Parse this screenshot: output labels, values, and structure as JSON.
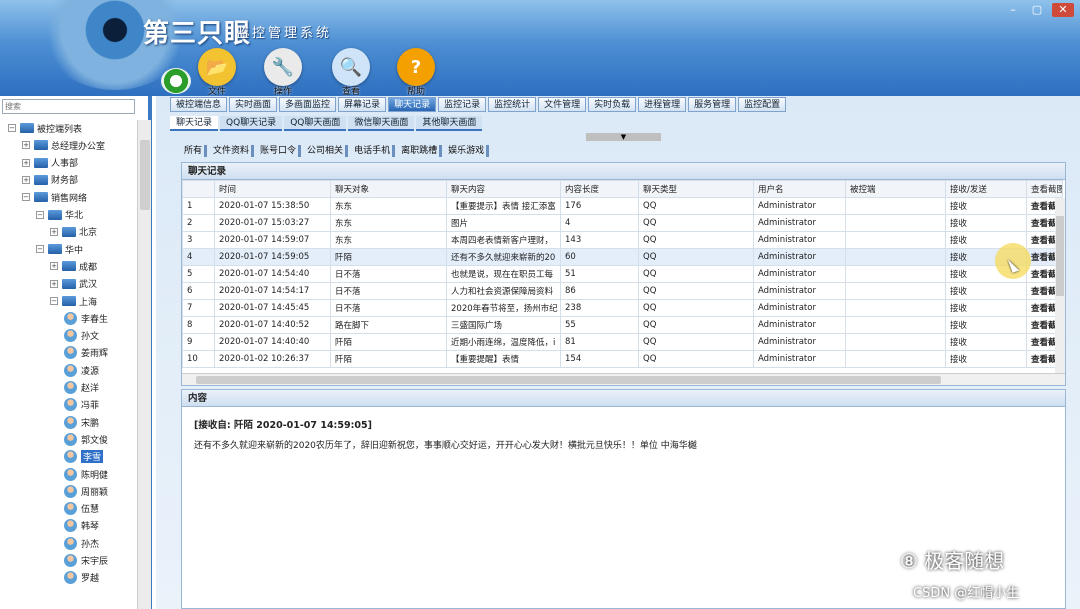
{
  "app": {
    "brand": "第三只眼",
    "subtitle": "监控管理系统"
  },
  "window_controls": [
    "–",
    "▢",
    "✕"
  ],
  "toolbar": [
    {
      "label": "文件",
      "icon": "folder-icon",
      "color": "#f2c230",
      "glyph": "📂"
    },
    {
      "label": "操作",
      "icon": "tools-icon",
      "color": "#eaeaea",
      "glyph": "🔧"
    },
    {
      "label": "查看",
      "icon": "magnifier-icon",
      "color": "#cfe4f8",
      "glyph": "🔍"
    },
    {
      "label": "帮助",
      "icon": "help-icon",
      "color": "#f4a000",
      "glyph": "?"
    }
  ],
  "sidebar": {
    "search_placeholder": "搜索",
    "tree": [
      {
        "label": "被控端列表",
        "indent": 0,
        "exp": "−",
        "type": "folder"
      },
      {
        "label": "总经理办公室",
        "indent": 1,
        "exp": "+",
        "type": "folder"
      },
      {
        "label": "人事部",
        "indent": 1,
        "exp": "+",
        "type": "folder"
      },
      {
        "label": "财务部",
        "indent": 1,
        "exp": "+",
        "type": "folder"
      },
      {
        "label": "销售网络",
        "indent": 1,
        "exp": "−",
        "type": "folder"
      },
      {
        "label": "华北",
        "indent": 2,
        "exp": "−",
        "type": "folder"
      },
      {
        "label": "北京",
        "indent": 3,
        "exp": "+",
        "type": "folder"
      },
      {
        "label": "华中",
        "indent": 2,
        "exp": "−",
        "type": "folder"
      },
      {
        "label": "成都",
        "indent": 3,
        "exp": "+",
        "type": "folder"
      },
      {
        "label": "武汉",
        "indent": 3,
        "exp": "+",
        "type": "folder"
      },
      {
        "label": "上海",
        "indent": 3,
        "exp": "−",
        "type": "folder"
      },
      {
        "label": "李春生",
        "indent": 4,
        "type": "user"
      },
      {
        "label": "孙文",
        "indent": 4,
        "type": "user"
      },
      {
        "label": "姜雨辉",
        "indent": 4,
        "type": "user"
      },
      {
        "label": "凌源",
        "indent": 4,
        "type": "user"
      },
      {
        "label": "赵洋",
        "indent": 4,
        "type": "user"
      },
      {
        "label": "冯菲",
        "indent": 4,
        "type": "user"
      },
      {
        "label": "宋鹏",
        "indent": 4,
        "type": "user"
      },
      {
        "label": "郭文俊",
        "indent": 4,
        "type": "user"
      },
      {
        "label": "李雪",
        "indent": 4,
        "type": "user",
        "selected": true
      },
      {
        "label": "陈明健",
        "indent": 4,
        "type": "user"
      },
      {
        "label": "周丽颖",
        "indent": 4,
        "type": "user"
      },
      {
        "label": "伍慧",
        "indent": 4,
        "type": "user"
      },
      {
        "label": "韩琴",
        "indent": 4,
        "type": "user"
      },
      {
        "label": "孙杰",
        "indent": 4,
        "type": "user"
      },
      {
        "label": "宋宇辰",
        "indent": 4,
        "type": "user"
      },
      {
        "label": "罗越",
        "indent": 4,
        "type": "user"
      }
    ]
  },
  "main_tabs": [
    {
      "label": "被控端信息"
    },
    {
      "label": "实时画面"
    },
    {
      "label": "多画面监控"
    },
    {
      "label": "屏幕记录"
    },
    {
      "label": "聊天记录",
      "active": true
    },
    {
      "label": "监控记录"
    },
    {
      "label": "监控统计"
    },
    {
      "label": "文件管理"
    },
    {
      "label": "实时负载"
    },
    {
      "label": "进程管理"
    },
    {
      "label": "服务管理"
    },
    {
      "label": "监控配置"
    }
  ],
  "sub_tabs": [
    {
      "label": "聊天记录",
      "active": true
    },
    {
      "label": "QQ聊天记录"
    },
    {
      "label": "QQ聊天画面"
    },
    {
      "label": "微信聊天画面"
    },
    {
      "label": "其他聊天画面"
    }
  ],
  "collapse_glyph": "▼",
  "filters": [
    "所有",
    "文件资料",
    "账号口令",
    "公司相关",
    "电话手机",
    "离职跳槽",
    "娱乐游戏"
  ],
  "grid": {
    "title": "聊天记录",
    "columns": [
      "",
      "时间",
      "聊天对象",
      "聊天内容",
      "内容长度",
      "聊天类型",
      "用户名",
      "被控端",
      "接收/发送",
      "查看截图"
    ],
    "rows": [
      [
        "1",
        "2020-01-07 15:38:50",
        "东东",
        "【重要提示】表情 接汇添富",
        "176",
        "QQ",
        "Administrator",
        "",
        "接收",
        "查看截"
      ],
      [
        "2",
        "2020-01-07 15:03:27",
        "东东",
        "图片",
        "4",
        "QQ",
        "Administrator",
        "",
        "接收",
        "查看截"
      ],
      [
        "3",
        "2020-01-07 14:59:07",
        "东东",
        "本周四老表情新客户理财，",
        "143",
        "QQ",
        "Administrator",
        "",
        "接收",
        "查看截"
      ],
      [
        "4",
        "2020-01-07 14:59:05",
        "阡陌",
        "还有不多久就迎来崭新的20",
        "60",
        "QQ",
        "Administrator",
        "",
        "接收",
        "查看截"
      ],
      [
        "5",
        "2020-01-07 14:54:40",
        "日不落",
        "也就是说，现在在职员工每",
        "51",
        "QQ",
        "Administrator",
        "",
        "接收",
        "查看截"
      ],
      [
        "6",
        "2020-01-07 14:54:17",
        "日不落",
        "人力和社会资源保障局资料",
        "86",
        "QQ",
        "Administrator",
        "",
        "接收",
        "查看截"
      ],
      [
        "7",
        "2020-01-07 14:45:45",
        "日不落",
        "2020年春节将至，扬州市纪",
        "238",
        "QQ",
        "Administrator",
        "",
        "接收",
        "查看截"
      ],
      [
        "8",
        "2020-01-07 14:40:52",
        "路在脚下",
        "三盛国际广场",
        "55",
        "QQ",
        "Administrator",
        "",
        "接收",
        "查看截"
      ],
      [
        "9",
        "2020-01-07 14:40:40",
        "阡陌",
        "近期小雨连绵，温度降低，i",
        "81",
        "QQ",
        "Administrator",
        "",
        "接收",
        "查看截"
      ],
      [
        "10",
        "2020-01-02 10:26:37",
        "阡陌",
        "【重要提醒】表情",
        "154",
        "QQ",
        "Administrator",
        "",
        "接收",
        "查看截"
      ]
    ],
    "highlight_row": 4
  },
  "detail": {
    "title": "内容",
    "meta": "[接收自: 阡陌 2020-01-07 14:59:05]",
    "text": "还有不多久就迎来崭新的2020农历年了，辞旧迎新祝您，事事顺心交好运，开开心心发大财！横批元旦快乐！！单位 中海华樾"
  },
  "watermark": {
    "line1": "⑧ 极客随想",
    "line2": "CSDN @红帽小生"
  }
}
